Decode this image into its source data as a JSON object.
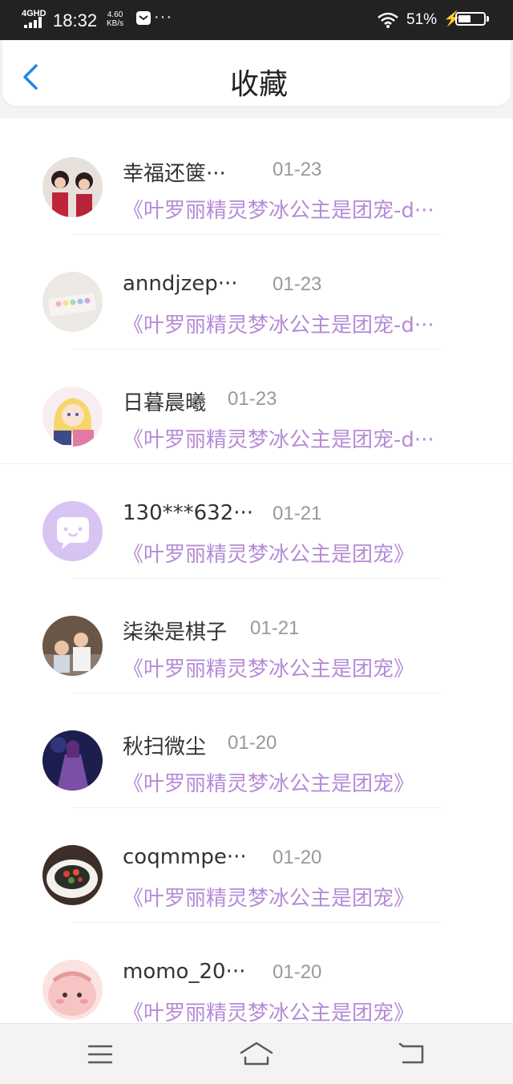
{
  "status_bar": {
    "network": "4GHD",
    "time": "18:32",
    "speed_value": "4.60",
    "speed_unit": "KB/s",
    "more": "···",
    "battery_percent_label": "51%",
    "battery_level": 0.51
  },
  "header": {
    "title": "收藏",
    "back_icon": "chevron-left-icon",
    "accent_color": "#1e88e5"
  },
  "favorites": [
    {
      "name": "幸福还箧···",
      "date": "01-23",
      "title": "《叶罗丽精灵梦冰公主是团宠-d···",
      "avatar": "avatar-two-girls-photo"
    },
    {
      "name": "anndjzep···",
      "date": "01-23",
      "title": "《叶罗丽精灵梦冰公主是团宠-d···",
      "avatar": "avatar-desk-items-photo"
    },
    {
      "name": "日暮晨曦",
      "date": "01-23",
      "title": "《叶罗丽精灵梦冰公主是团宠-d···",
      "avatar": "avatar-anime-girl"
    },
    {
      "name": "130***632···",
      "date": "01-21",
      "title": "《叶罗丽精灵梦冰公主是团宠》",
      "avatar": "avatar-default-chat-bubble"
    },
    {
      "name": "柒染是棋子",
      "date": "01-21",
      "title": "《叶罗丽精灵梦冰公主是团宠》",
      "avatar": "avatar-two-children-photo"
    },
    {
      "name": "秋扫微尘",
      "date": "01-20",
      "title": "《叶罗丽精灵梦冰公主是团宠》",
      "avatar": "avatar-fantasy-character"
    },
    {
      "name": "coqmmpe···",
      "date": "01-20",
      "title": "《叶罗丽精灵梦冰公主是团宠》",
      "avatar": "avatar-food-dish-photo"
    },
    {
      "name": "momo_20···",
      "date": "01-20",
      "title": "《叶罗丽精灵梦冰公主是团宠》",
      "avatar": "avatar-pink-cartoon-face"
    }
  ],
  "colors": {
    "link": "#b58bd6",
    "name": "#333333",
    "date": "#999999",
    "default_avatar_bg": "#d8c4f2"
  },
  "nav_bar": {
    "menu_icon": "menu-icon",
    "home_icon": "home-icon",
    "back_icon": "back-arrow-icon"
  }
}
